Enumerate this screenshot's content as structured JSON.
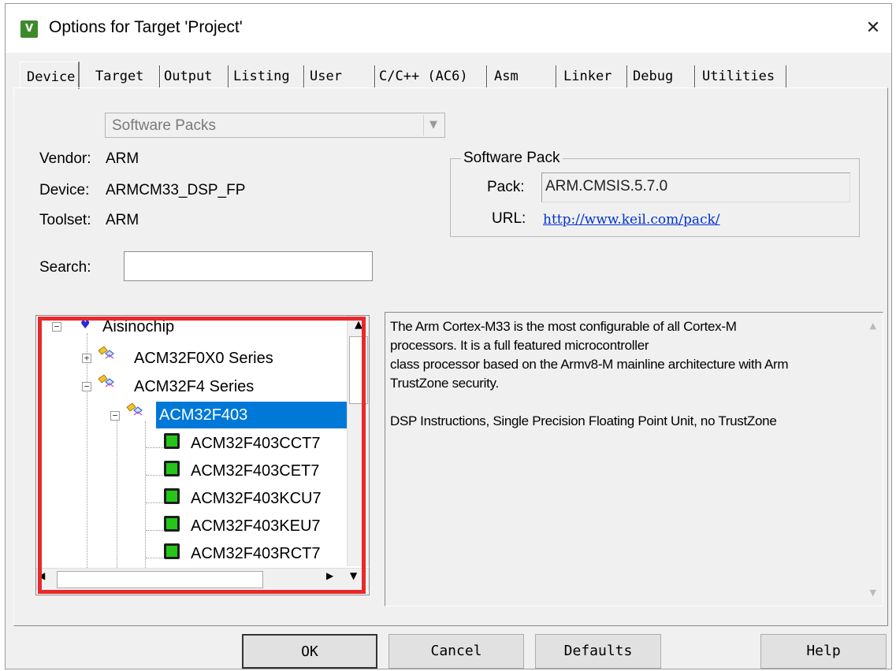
{
  "window": {
    "title": "Options for Target 'Project'",
    "app_icon_glyph": "V",
    "close_glyph": "✕"
  },
  "tabs": [
    {
      "label": "Device",
      "active": true
    },
    {
      "label": "Target"
    },
    {
      "label": "Output"
    },
    {
      "label": "Listing"
    },
    {
      "label": "User"
    },
    {
      "label": "C/C++ (AC6)"
    },
    {
      "label": "Asm"
    },
    {
      "label": "Linker"
    },
    {
      "label": "Debug"
    },
    {
      "label": "Utilities"
    }
  ],
  "device_db": {
    "selected": "Software Packs",
    "arrow_glyph": "▼"
  },
  "info": {
    "vendor_label": "Vendor:",
    "vendor_value": "ARM",
    "device_label": "Device:",
    "device_value": "ARMCM33_DSP_FP",
    "toolset_label": "Toolset:",
    "toolset_value": "ARM"
  },
  "software_pack": {
    "group_title": "Software Pack",
    "pack_label": "Pack:",
    "pack_value": "ARM.CMSIS.5.7.0",
    "url_label": "URL:",
    "url_value": "http://www.keil.com/pack/"
  },
  "search": {
    "label": "Search:",
    "value": ""
  },
  "tree": {
    "vendor": "Aisinochip",
    "series": [
      "ACM32F0X0 Series",
      "ACM32F4 Series"
    ],
    "selected_device": "ACM32F403",
    "devices": [
      "ACM32F403CCT7",
      "ACM32F403CET7",
      "ACM32F403KCU7",
      "ACM32F403KEU7",
      "ACM32F403RCT7"
    ],
    "expand_plus": "+",
    "expand_minus": "−"
  },
  "description": {
    "text": "The Arm Cortex-M33 is the most configurable of all Cortex-M\nprocessors. It is a full featured microcontroller\nclass processor based on the Armv8-M mainline architecture with Arm\nTrustZone security.\n\nDSP Instructions, Single Precision Floating Point Unit, no TrustZone"
  },
  "buttons": {
    "ok": "OK",
    "cancel": "Cancel",
    "defaults": "Defaults",
    "help": "Help"
  },
  "colors": {
    "highlight_box": "#e8292b",
    "selection": "#0078d7",
    "link": "#0033cc"
  }
}
